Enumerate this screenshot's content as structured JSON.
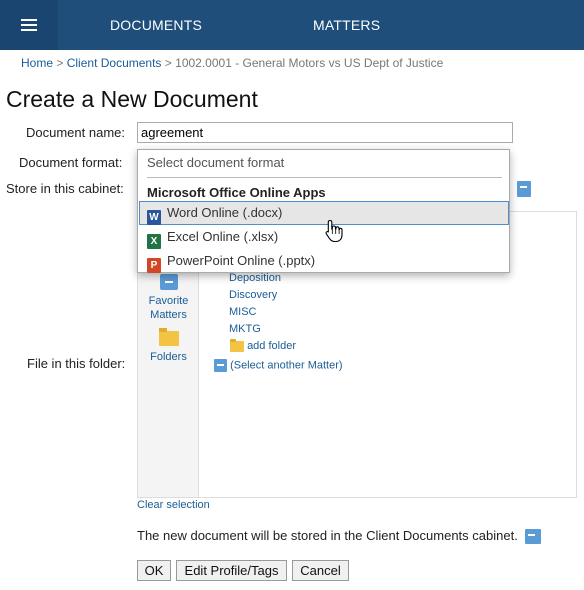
{
  "nav": {
    "menu_icon": "hamburger-menu-icon",
    "tabs": [
      "DOCUMENTS",
      "MATTERS"
    ]
  },
  "breadcrumb": {
    "home": "Home",
    "client_documents": "Client Documents",
    "current": "1002.0001 - General Motors vs US Dept of Justice",
    "separator": ">"
  },
  "page_title": "Create a New Document",
  "form": {
    "document_name_label": "Document name:",
    "document_name_value": "agreement",
    "document_format_label": "Document format:",
    "store_cabinet_label": "Store in this cabinet:",
    "file_folder_label": "File in this folder:"
  },
  "dropdown": {
    "search_placeholder": "Select document format",
    "group_label": "Microsoft Office Online Apps",
    "options": [
      {
        "label": "Word Online (.docx)",
        "icon": "word-icon",
        "letter": "W",
        "color": "#2b579a",
        "highlighted": true
      },
      {
        "label": "Excel Online (.xlsx)",
        "icon": "excel-icon",
        "letter": "X",
        "color": "#217346",
        "highlighted": false
      },
      {
        "label": "PowerPoint Online (.pptx)",
        "icon": "powerpoint-icon",
        "letter": "P",
        "color": "#d24726",
        "highlighted": false
      }
    ]
  },
  "tree": {
    "side": {
      "favorite_matters": "Favorite Matters",
      "folders": "Folders"
    },
    "folders": [
      "Deposition",
      "Discovery",
      "MISC",
      "MKTG"
    ],
    "add_folder": "add folder",
    "select_matter": "(Select another Matter)"
  },
  "clear_selection": "Clear selection",
  "note": "The new document will be stored in the Client Documents cabinet.",
  "buttons": {
    "ok": "OK",
    "edit_profile": "Edit Profile/Tags",
    "cancel": "Cancel"
  },
  "colors": {
    "topbar": "#1e4e79",
    "link": "#1b5d97",
    "highlight_border": "#4d8fd0"
  }
}
